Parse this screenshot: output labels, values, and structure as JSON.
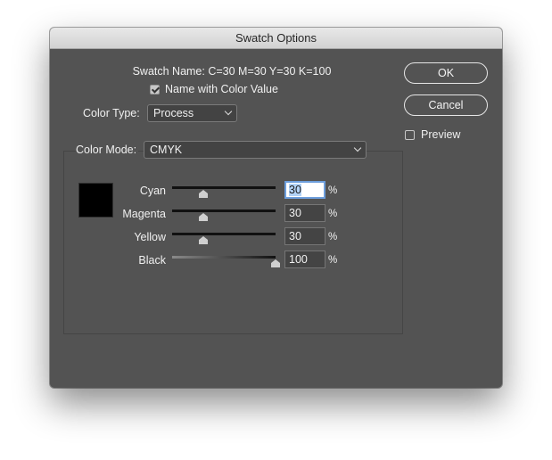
{
  "dialog": {
    "title": "Swatch Options",
    "swatch_name_label": "Swatch Name:",
    "swatch_name_value": "C=30 M=30 Y=30 K=100",
    "name_with_color_value": {
      "label": "Name with Color Value",
      "checked": true
    },
    "color_type": {
      "label": "Color Type:",
      "value": "Process"
    },
    "color_mode": {
      "label": "Color Mode:",
      "value": "CMYK"
    },
    "buttons": {
      "ok": "OK",
      "cancel": "Cancel"
    },
    "preview": {
      "label": "Preview",
      "checked": false
    },
    "preview_swatch_color": "#000000",
    "channels": [
      {
        "name": "Cyan",
        "value": "30",
        "unit": "%",
        "fraction": 0.3
      },
      {
        "name": "Magenta",
        "value": "30",
        "unit": "%",
        "fraction": 0.3
      },
      {
        "name": "Yellow",
        "value": "30",
        "unit": "%",
        "fraction": 0.3
      },
      {
        "name": "Black",
        "value": "100",
        "unit": "%",
        "fraction": 1.0
      }
    ]
  }
}
